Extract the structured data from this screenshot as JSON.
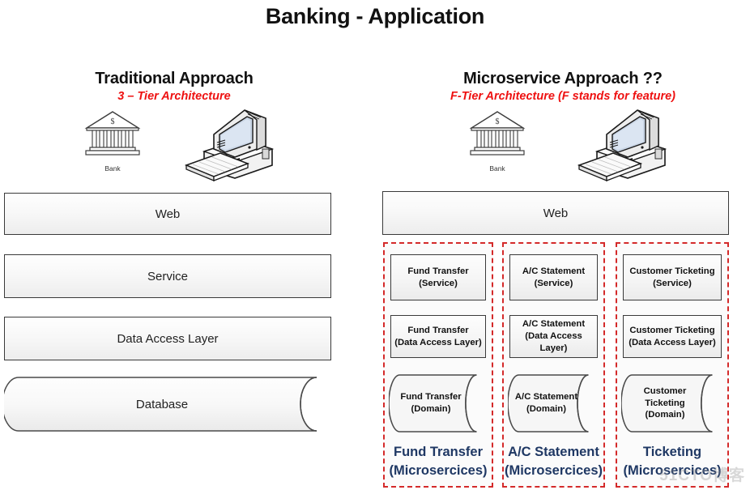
{
  "page": {
    "title": "Banking - Application",
    "watermark": "51CTO博客"
  },
  "colors": {
    "accent_red": "#ee1111",
    "dashed_border": "#d42a2a",
    "microservice_label": "#1f3864",
    "box_border": "#3a3a3a"
  },
  "left": {
    "heading": "Traditional Approach",
    "subheading": "3 – Tier Architecture",
    "bank_icon_label": "Bank",
    "tiers": [
      {
        "label": "Web"
      },
      {
        "label": "Service"
      },
      {
        "label": "Data Access Layer"
      },
      {
        "label": "Database"
      }
    ]
  },
  "right": {
    "heading": "Microservice Approach ??",
    "subheading": "F-Tier Architecture (F stands for feature)",
    "bank_icon_label": "Bank",
    "web_label": "Web",
    "columns": [
      {
        "service_line1": "Fund Transfer",
        "service_line2": "(Service)",
        "dal_line1": "Fund Transfer",
        "dal_line2": "(Data Access Layer)",
        "domain_line1": "Fund Transfer",
        "domain_line2": "(Domain)",
        "domain_line3": "",
        "title_line1": "Fund Transfer",
        "title_line2": "(Microsercices)"
      },
      {
        "service_line1": "A/C Statement",
        "service_line2": "(Service)",
        "dal_line1": "A/C Statement",
        "dal_line2": "(Data Access Layer)",
        "domain_line1": "A/C Statement",
        "domain_line2": "(Domain)",
        "domain_line3": "",
        "title_line1": "A/C Statement",
        "title_line2": "(Microsercices)"
      },
      {
        "service_line1": "Customer Ticketing",
        "service_line2": "(Service)",
        "dal_line1": "Customer Ticketing",
        "dal_line2": "(Data Access Layer)",
        "domain_line1": "Customer",
        "domain_line2": "Ticketing",
        "domain_line3": "(Domain)",
        "title_line1": "Ticketing",
        "title_line2": "(Microsercices)"
      }
    ]
  }
}
